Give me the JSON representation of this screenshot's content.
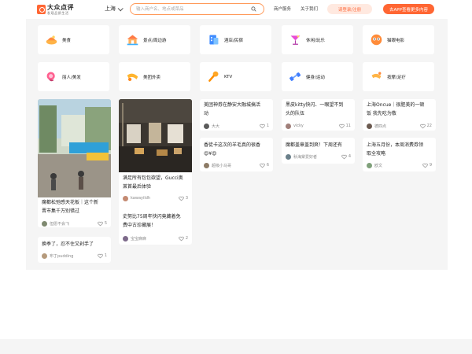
{
  "header": {
    "logo_title": "大众点评",
    "logo_sub": "发现品质生活",
    "city": "上海",
    "search_placeholder": "输入商户名、地点或菜品",
    "nav_merchant": "商户服务",
    "nav_about": "关于我们",
    "login_label": "请登录/注册",
    "app_label": "去APP查看更多内容"
  },
  "categories": [
    {
      "label": "美食",
      "icon": "food-icon"
    },
    {
      "label": "景点/周边游",
      "icon": "scenic-icon"
    },
    {
      "label": "酒店/民宿",
      "icon": "hotel-icon"
    },
    {
      "label": "休闲/玩乐",
      "icon": "cocktail-icon"
    },
    {
      "label": "猫眼电影",
      "icon": "movie-icon"
    },
    {
      "label": "丽人/美发",
      "icon": "beauty-icon"
    },
    {
      "label": "美团外卖",
      "icon": "takeout-icon"
    },
    {
      "label": "KTV",
      "icon": "microphone-icon"
    },
    {
      "label": "健身/运动",
      "icon": "dumbbell-icon"
    },
    {
      "label": "按摩/足疗",
      "icon": "massage-icon"
    }
  ],
  "feed": [
    {
      "title_lines": [
        "魔都松弛感天花板｜这个新",
        "晋市集千万别错过"
      ],
      "author": "但愿不会飞",
      "likes": "5"
    },
    {
      "title_lines": [
        "换季了，忍不住又剁手了"
      ],
      "author": "布丁pudding",
      "likes": "1"
    },
    {
      "title_lines": [
        "满足所有包包欲望，Gucci奥",
        "莱首最后体验"
      ],
      "author": "kawayildh",
      "likes": "3"
    },
    {
      "title_lines": [
        "史努比75周年快闪竟藏着免",
        "费中古珍藏展！"
      ],
      "author": "宝宝麻麻",
      "likes": "2"
    },
    {
      "title_lines": [
        "美团神券在静安大融城搞活",
        "动"
      ],
      "author": "大大",
      "likes": "1"
    },
    {
      "title_lines": [
        "香徒卡这次的羊毛真的很香",
        "😍¥😍"
      ],
      "author": "超级小马哥",
      "likes": "6"
    },
    {
      "title_lines": [
        "黑皮kitty快闪、一眼望不到",
        "头的队伍"
      ],
      "author": "vicky",
      "likes": "11"
    },
    {
      "title_lines": [
        "魔都盖章盖到爽！下周还有"
      ],
      "author": "秋海棠爱好者",
      "likes": "4"
    },
    {
      "title_lines": [
        "上海Oncue｜很肥美的一顿",
        "饭 我先吃为敬"
      ],
      "author": "德四点",
      "likes": "22"
    },
    {
      "title_lines": [
        "上海五月份，本周消费券领",
        "取全攻略"
      ],
      "author": "欧文",
      "likes": "9"
    }
  ],
  "colors": {
    "brand": "#ff6633",
    "panel": "#f5f5f5"
  }
}
